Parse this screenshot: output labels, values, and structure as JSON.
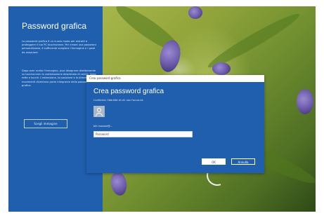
{
  "left_panel": {
    "title": "Password grafica",
    "paragraph1": "La password grafica è un nuovo modo per aiutarti a proteggere il tuo PC touchscreen. Per creare una password personalizzata, è sufficiente scegliere l'immagine e i gesti da associare.",
    "paragraph2": "Dopo aver scelto l'immagine, puoi disegnare direttamente su touchscreen la combinazione desiderata di cerchi, linee rette e tocchi. L'estensione, la posizione e la direzione dei movimenti diventano parte integrante della password grafica.",
    "choose_button": "Scegli immagine"
  },
  "dialog": {
    "titlebar": "Crea password grafica",
    "heading": "Crea password grafica",
    "subtitle": "Conferma l'identità di chi usa l'account.",
    "account_label": "bill.mossee@...",
    "password_value": "Password",
    "ok_label": "OK",
    "cancel_label": "Annulla"
  },
  "icons": {
    "avatar": "user-avatar-icon",
    "gesture": "circle-gesture-icon"
  },
  "colors": {
    "accent_blue": "#1f5fae",
    "text_white": "#ffffff"
  }
}
